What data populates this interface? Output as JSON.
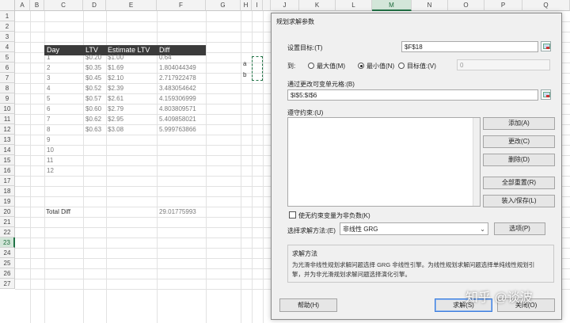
{
  "spreadsheet": {
    "columns": [
      "A",
      "B",
      "C",
      "D",
      "E",
      "F",
      "G",
      "H",
      "I",
      "J",
      "K",
      "L",
      "M",
      "N",
      "O",
      "P",
      "Q"
    ],
    "rows": [
      "1",
      "2",
      "3",
      "4",
      "5",
      "6",
      "7",
      "8",
      "9",
      "10",
      "11",
      "12",
      "13",
      "14",
      "15",
      "16",
      "17",
      "18",
      "19",
      "20",
      "21",
      "22",
      "23",
      "24",
      "25",
      "26",
      "27"
    ],
    "selected_column": "M",
    "selected_row": "23",
    "table_header": {
      "day": "Day",
      "ltv": "LTV",
      "estimate_ltv": "Estimate LTV",
      "diff": "Diff"
    },
    "table_rows": [
      {
        "day": "1",
        "ltv": "$0.20",
        "est": "$1.00",
        "diff": "0.64"
      },
      {
        "day": "2",
        "ltv": "$0.35",
        "est": "$1.69",
        "diff": "1.804044349"
      },
      {
        "day": "3",
        "ltv": "$0.45",
        "est": "$2.10",
        "diff": "2.717922478"
      },
      {
        "day": "4",
        "ltv": "$0.52",
        "est": "$2.39",
        "diff": "3.483054642"
      },
      {
        "day": "5",
        "ltv": "$0.57",
        "est": "$2.61",
        "diff": "4.159306999"
      },
      {
        "day": "6",
        "ltv": "$0.60",
        "est": "$2.79",
        "diff": "4.803809571"
      },
      {
        "day": "7",
        "ltv": "$0.62",
        "est": "$2.95",
        "diff": "5.409858021"
      },
      {
        "day": "8",
        "ltv": "$0.63",
        "est": "$3.08",
        "diff": "5.999763866"
      },
      {
        "day": "9",
        "ltv": "",
        "est": "",
        "diff": ""
      },
      {
        "day": "10",
        "ltv": "",
        "est": "",
        "diff": ""
      },
      {
        "day": "11",
        "ltv": "",
        "est": "",
        "diff": ""
      },
      {
        "day": "12",
        "ltv": "",
        "est": "",
        "diff": ""
      }
    ],
    "total_label": "Total Diff",
    "total_value": "29.01775993",
    "param_a": "a",
    "param_b": "b",
    "header_fill": "#3b3b3b"
  },
  "dialog": {
    "title": "规划求解参数",
    "target_label": "设置目标:(T)",
    "target_value": "$F$18",
    "to_label": "到:",
    "opt_max": "最大值(M)",
    "opt_min": "最小值(N)",
    "opt_value": "目标值:(V)",
    "value_field": "0",
    "changing_label": "通过更改可变单元格:(B)",
    "changing_value": "$I$5:$I$6",
    "constraints_label": "遵守约束:(U)",
    "btn_add": "添加(A)",
    "btn_change": "更改(C)",
    "btn_delete": "删除(D)",
    "btn_reset": "全部重置(R)",
    "btn_load_save": "装入/保存(L)",
    "nonneg_label": "使无约束变量为非负数(K)",
    "method_label": "选择求解方法:(E)",
    "method_value": "非线性 GRG",
    "btn_options": "选项(P)",
    "method_section_title": "求解方法",
    "method_desc_1": "为光滑非线性规划求解问题选择 GRG 非线性引擎。为线性规划求解问题选择单纯线性规划引",
    "method_desc_2": "擎，并为非光滑规划求解问题选择演化引擎。",
    "btn_help": "帮助(H)",
    "btn_solve": "求解(S)",
    "btn_close": "关闭(O)",
    "watermark": "知乎 @谈波",
    "accent": "#217346"
  }
}
